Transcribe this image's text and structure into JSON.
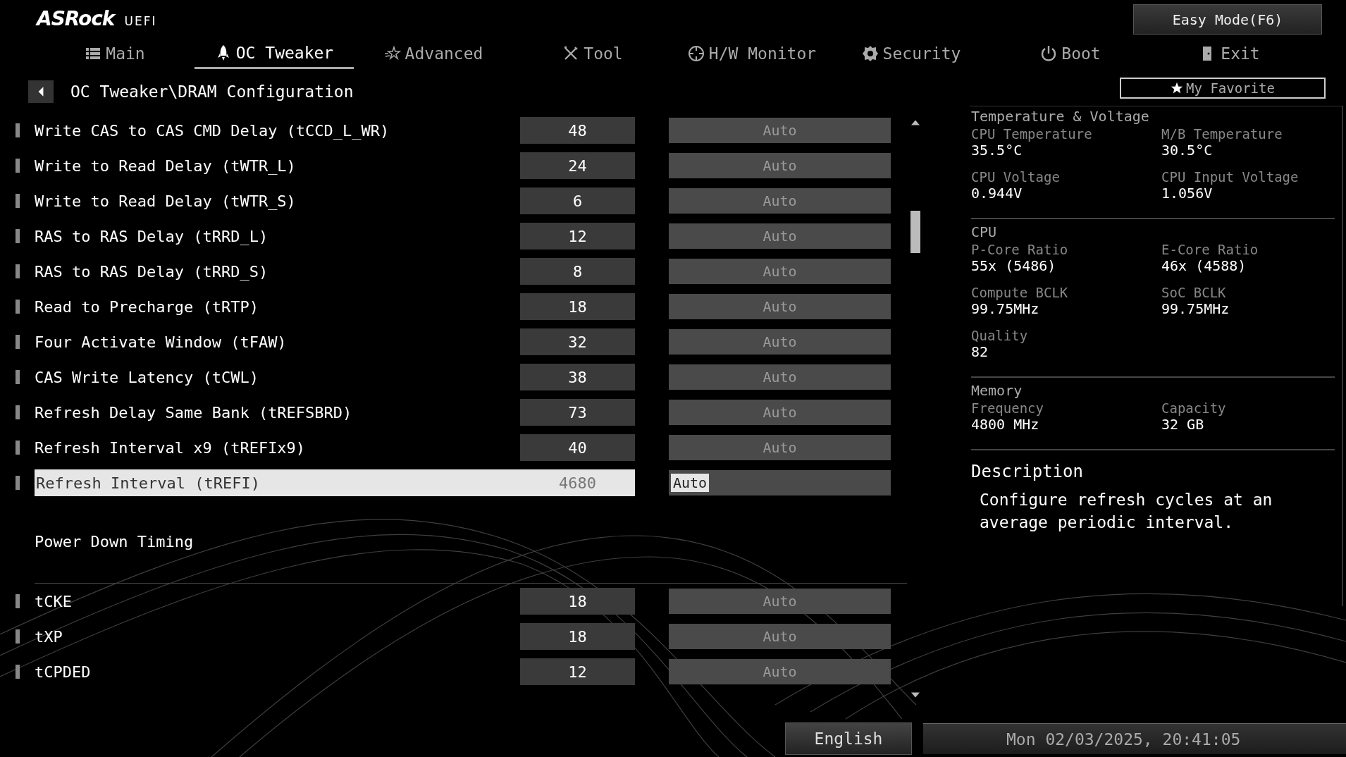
{
  "brand": {
    "logo": "ASRock",
    "suffix": "UEFI"
  },
  "easy_mode_button": "Easy Mode(F6)",
  "tabs": [
    {
      "label": "Main",
      "selected": false
    },
    {
      "label": "OC Tweaker",
      "selected": true
    },
    {
      "label": "Advanced",
      "selected": false
    },
    {
      "label": "Tool",
      "selected": false
    },
    {
      "label": "H/W Monitor",
      "selected": false
    },
    {
      "label": "Security",
      "selected": false
    },
    {
      "label": "Boot",
      "selected": false
    },
    {
      "label": "Exit",
      "selected": false
    }
  ],
  "breadcrumb": "OC Tweaker\\DRAM Configuration",
  "favorite_button": "My Favorite",
  "settings": [
    {
      "kind": "row",
      "label": "Write CAS to CAS CMD Delay (tCCD_L_WR)",
      "value": "48",
      "option": "Auto",
      "selected": false
    },
    {
      "kind": "row",
      "label": "Write to Read Delay (tWTR_L)",
      "value": "24",
      "option": "Auto",
      "selected": false
    },
    {
      "kind": "row",
      "label": "Write to Read Delay (tWTR_S)",
      "value": "6",
      "option": "Auto",
      "selected": false
    },
    {
      "kind": "row",
      "label": "RAS to RAS Delay (tRRD_L)",
      "value": "12",
      "option": "Auto",
      "selected": false
    },
    {
      "kind": "row",
      "label": "RAS to RAS Delay (tRRD_S)",
      "value": "8",
      "option": "Auto",
      "selected": false
    },
    {
      "kind": "row",
      "label": "Read to Precharge (tRTP)",
      "value": "18",
      "option": "Auto",
      "selected": false
    },
    {
      "kind": "row",
      "label": "Four Activate Window (tFAW)",
      "value": "32",
      "option": "Auto",
      "selected": false
    },
    {
      "kind": "row",
      "label": "CAS Write Latency (tCWL)",
      "value": "38",
      "option": "Auto",
      "selected": false
    },
    {
      "kind": "row",
      "label": "Refresh Delay Same Bank (tREFSBRD)",
      "value": "73",
      "option": "Auto",
      "selected": false
    },
    {
      "kind": "row",
      "label": "Refresh Interval x9 (tREFIx9)",
      "value": "40",
      "option": "Auto",
      "selected": false
    },
    {
      "kind": "row",
      "label": "Refresh Interval (tREFI)",
      "value": "4680",
      "option": "Auto",
      "selected": true
    },
    {
      "kind": "section",
      "label": "Power Down Timing"
    },
    {
      "kind": "row",
      "label": "tCKE",
      "value": "18",
      "option": "Auto",
      "selected": false
    },
    {
      "kind": "row",
      "label": "tXP",
      "value": "18",
      "option": "Auto",
      "selected": false
    },
    {
      "kind": "row",
      "label": "tCPDED",
      "value": "12",
      "option": "Auto",
      "selected": false
    }
  ],
  "info_sections": [
    {
      "title": "Temperature & Voltage",
      "items": [
        {
          "label": "CPU Temperature",
          "value": "35.5°C"
        },
        {
          "label": "M/B Temperature",
          "value": "30.5°C"
        },
        {
          "label": "CPU Voltage",
          "value": "0.944V"
        },
        {
          "label": "CPU Input Voltage",
          "value": "1.056V"
        }
      ]
    },
    {
      "title": "CPU",
      "items": [
        {
          "label": "P-Core Ratio",
          "value": "55x (5486)"
        },
        {
          "label": "E-Core Ratio",
          "value": "46x (4588)"
        },
        {
          "label": "Compute BCLK",
          "value": "99.75MHz"
        },
        {
          "label": "SoC BCLK",
          "value": "99.75MHz"
        },
        {
          "label": "Quality",
          "value": "82"
        }
      ]
    },
    {
      "title": "Memory",
      "items": [
        {
          "label": "Frequency",
          "value": "4800 MHz"
        },
        {
          "label": "Capacity",
          "value": "32 GB"
        }
      ]
    }
  ],
  "description": {
    "title": "Description",
    "text": "Configure refresh cycles at an average periodic interval."
  },
  "language_button": "English",
  "datetime": "Mon 02/03/2025, 20:41:05"
}
